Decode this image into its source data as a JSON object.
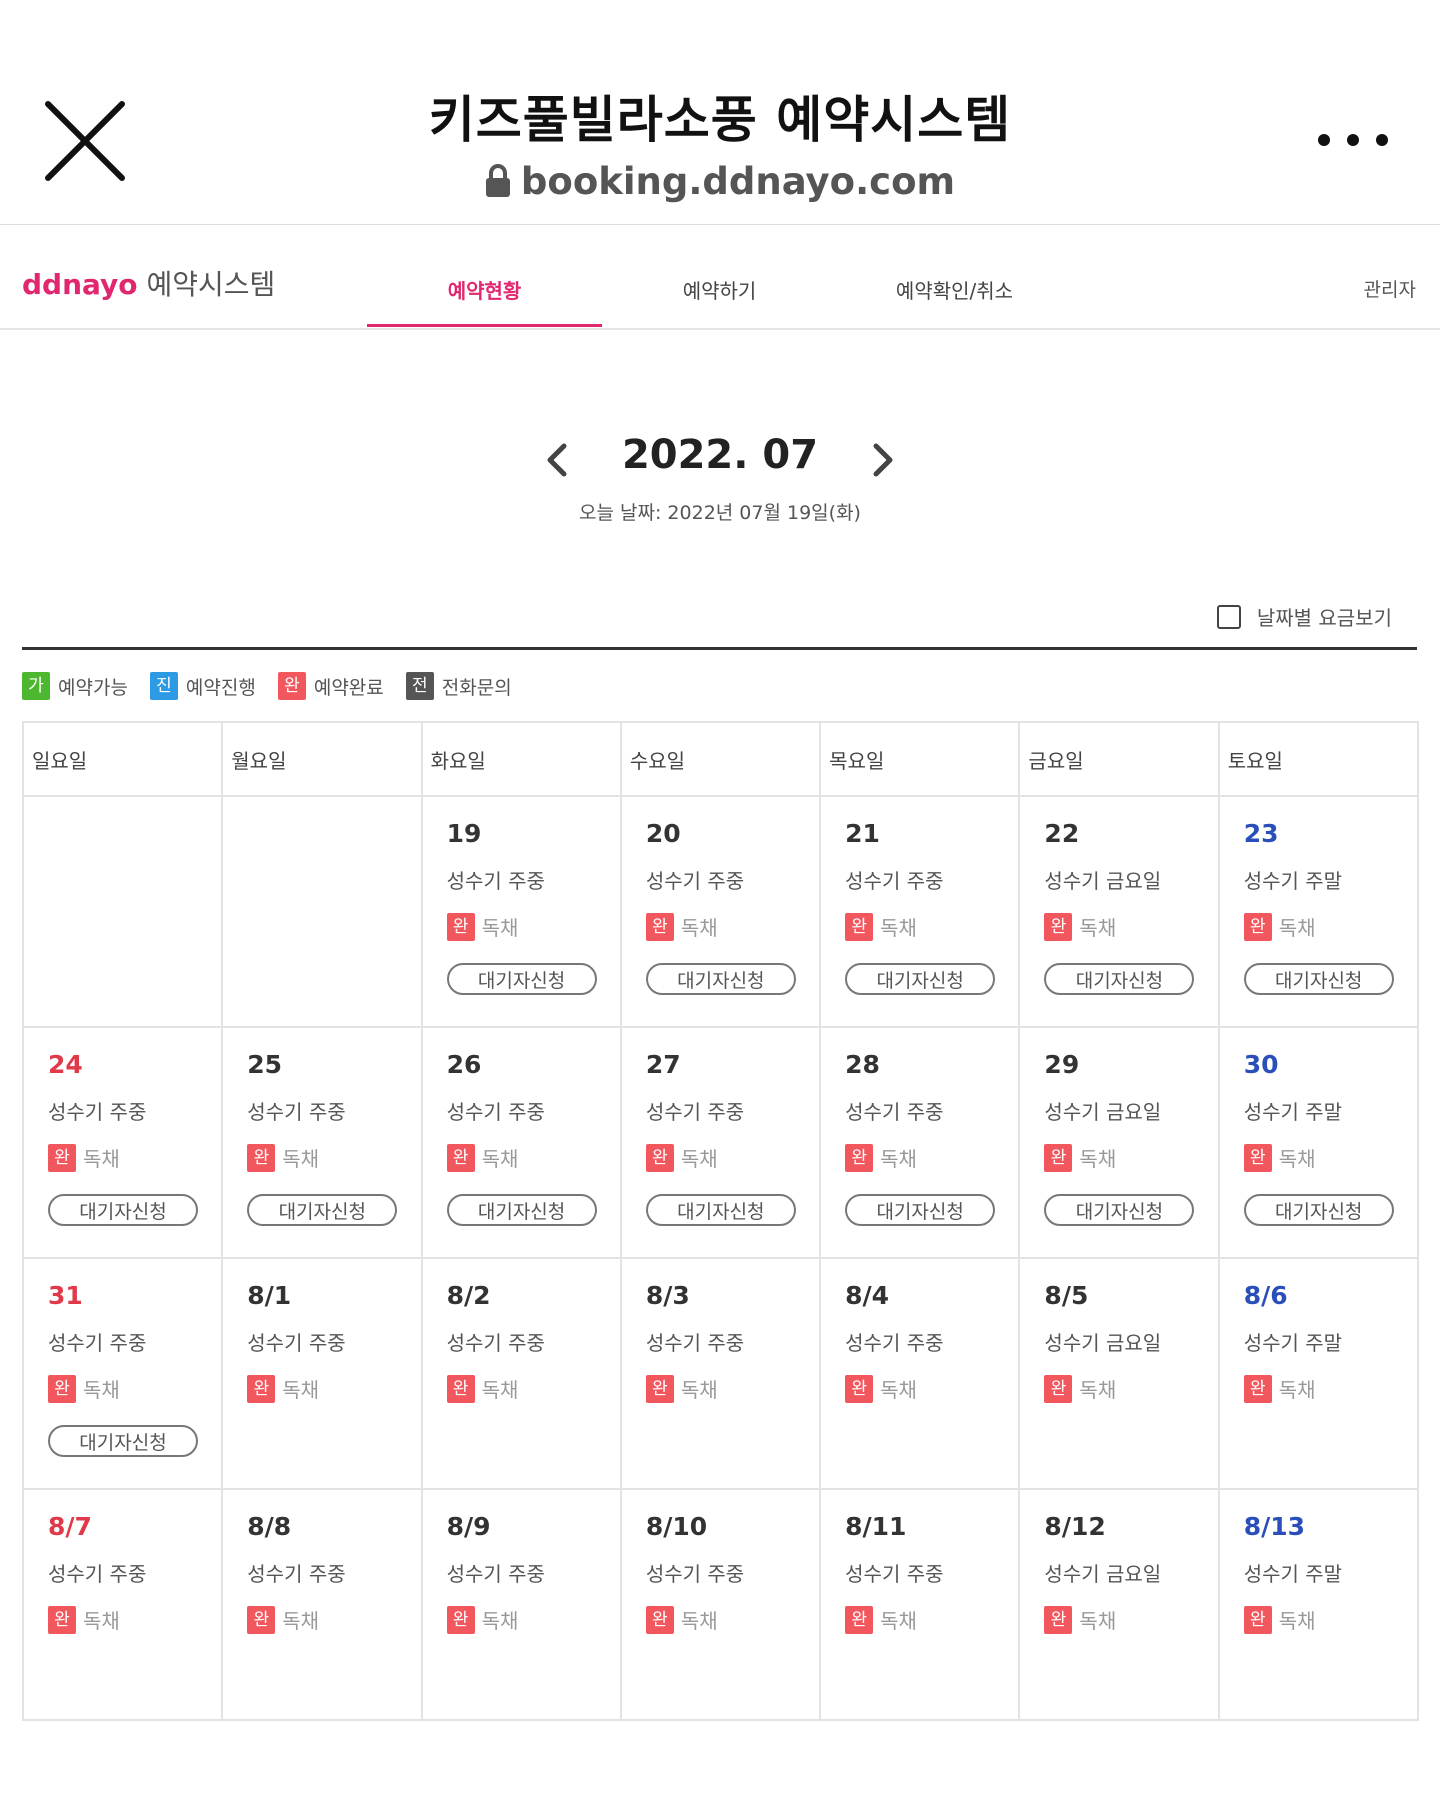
{
  "browser": {
    "title": "키즈풀빌라소풍 예약시스템",
    "url": "booking.ddnayo.com"
  },
  "site": {
    "brand": "ddnayo",
    "brand_suffix": "예약시스템",
    "tabs": [
      "예약현황",
      "예약하기",
      "예약확인/취소"
    ],
    "admin": "관리자"
  },
  "calendar": {
    "month_label": "2022. 07",
    "today_label": "오늘 날짜: 2022년 07월 19일(화)",
    "price_toggle_label": "날짜별 요금보기",
    "legend": [
      {
        "badge": "가",
        "label": "예약가능",
        "color": "#4db82f"
      },
      {
        "badge": "진",
        "label": "예약진행",
        "color": "#2d9ae6"
      },
      {
        "badge": "완",
        "label": "예약완료",
        "color": "#f2575e"
      },
      {
        "badge": "전",
        "label": "전화문의",
        "color": "#555555"
      }
    ],
    "weekdays": [
      "일요일",
      "월요일",
      "화요일",
      "수요일",
      "목요일",
      "금요일",
      "토요일"
    ],
    "room_name": "독채",
    "status_badge": "완",
    "waitlist_label": "대기자신청",
    "weeks": [
      [
        null,
        null,
        {
          "date": "19",
          "season": "성수기 주중",
          "waitlist": true
        },
        {
          "date": "20",
          "season": "성수기 주중",
          "waitlist": true
        },
        {
          "date": "21",
          "season": "성수기 주중",
          "waitlist": true
        },
        {
          "date": "22",
          "season": "성수기 금요일",
          "waitlist": true
        },
        {
          "date": "23",
          "season": "성수기 주말",
          "waitlist": true
        }
      ],
      [
        {
          "date": "24",
          "season": "성수기 주중",
          "waitlist": true
        },
        {
          "date": "25",
          "season": "성수기 주중",
          "waitlist": true
        },
        {
          "date": "26",
          "season": "성수기 주중",
          "waitlist": true
        },
        {
          "date": "27",
          "season": "성수기 주중",
          "waitlist": true
        },
        {
          "date": "28",
          "season": "성수기 주중",
          "waitlist": true
        },
        {
          "date": "29",
          "season": "성수기 금요일",
          "waitlist": true
        },
        {
          "date": "30",
          "season": "성수기 주말",
          "waitlist": true
        }
      ],
      [
        {
          "date": "31",
          "season": "성수기 주중",
          "waitlist": true
        },
        {
          "date": "8/1",
          "season": "성수기 주중",
          "waitlist": false
        },
        {
          "date": "8/2",
          "season": "성수기 주중",
          "waitlist": false
        },
        {
          "date": "8/3",
          "season": "성수기 주중",
          "waitlist": false
        },
        {
          "date": "8/4",
          "season": "성수기 주중",
          "waitlist": false
        },
        {
          "date": "8/5",
          "season": "성수기 금요일",
          "waitlist": false
        },
        {
          "date": "8/6",
          "season": "성수기 주말",
          "waitlist": false
        }
      ],
      [
        {
          "date": "8/7",
          "season": "성수기 주중",
          "waitlist": false
        },
        {
          "date": "8/8",
          "season": "성수기 주중",
          "waitlist": false
        },
        {
          "date": "8/9",
          "season": "성수기 주중",
          "waitlist": false
        },
        {
          "date": "8/10",
          "season": "성수기 주중",
          "waitlist": false
        },
        {
          "date": "8/11",
          "season": "성수기 주중",
          "waitlist": false
        },
        {
          "date": "8/12",
          "season": "성수기 금요일",
          "waitlist": false
        },
        {
          "date": "8/13",
          "season": "성수기 주말",
          "waitlist": false
        }
      ]
    ]
  },
  "icons": {
    "close": "close-icon",
    "lock": "lock-icon",
    "more": "more-icon",
    "prev": "chevron-left-icon",
    "next": "chevron-right-icon"
  },
  "colors": {
    "brand": "#e0276f",
    "sunday": "#e0394a",
    "saturday": "#2a4fbb"
  }
}
